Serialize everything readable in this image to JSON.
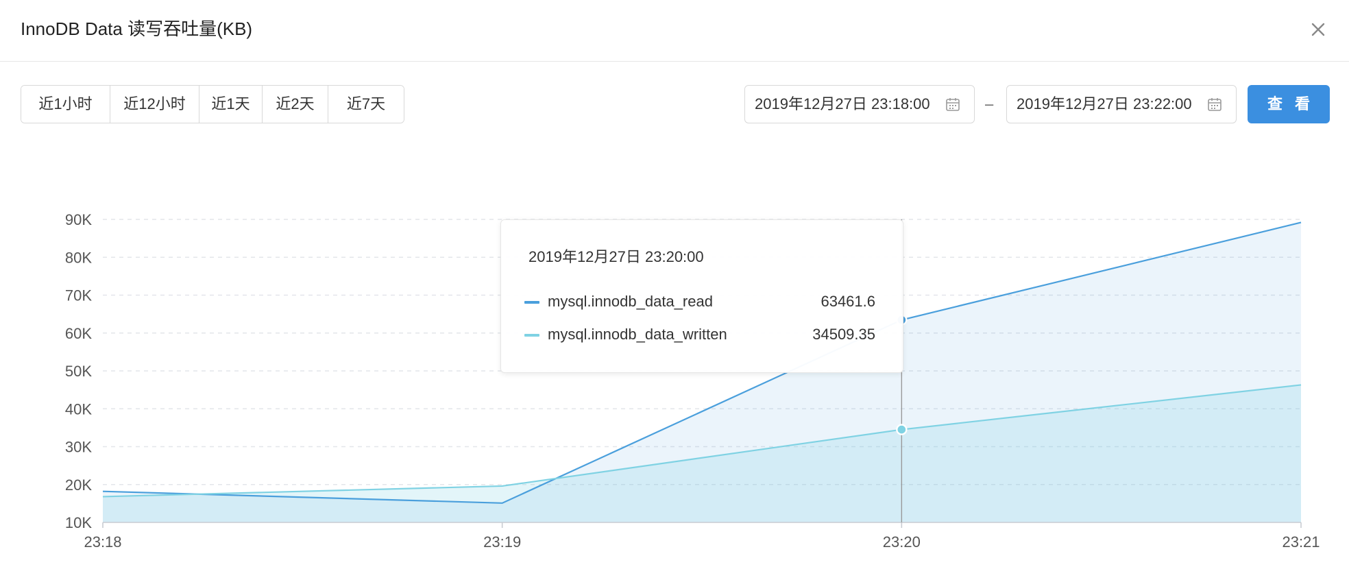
{
  "dialog": {
    "title": "InnoDB Data 读写吞吐量(KB)"
  },
  "toolbar": {
    "quick_ranges": [
      "近1小时",
      "近12小时",
      "近1天",
      "近2天",
      "近7天"
    ],
    "start_date": "2019年12月27日 23:18:00",
    "separator": "–",
    "end_date": "2019年12月27日 23:22:00",
    "view_label": "查 看"
  },
  "colors": {
    "read": "#4a9fdc",
    "written": "#7fd2e3",
    "accent": "#3b8fe0"
  },
  "icons": {
    "close": "close-icon",
    "calendar": "calendar-icon"
  },
  "tooltip": {
    "time": "2019年12月27日 23:20:00",
    "rows": [
      {
        "name": "mysql.innodb_data_read",
        "value": "63461.6"
      },
      {
        "name": "mysql.innodb_data_written",
        "value": "34509.35"
      }
    ]
  },
  "chart_data": {
    "type": "area",
    "x": [
      "23:18",
      "23:19",
      "23:20",
      "23:21"
    ],
    "series": [
      {
        "name": "mysql.innodb_data_read",
        "values": [
          18200,
          15100,
          63461.6,
          89200
        ]
      },
      {
        "name": "mysql.innodb_data_written",
        "values": [
          16800,
          19600,
          34509.35,
          46300
        ]
      }
    ],
    "yticks": [
      "10K",
      "20K",
      "30K",
      "40K",
      "50K",
      "60K",
      "70K",
      "80K",
      "90K"
    ],
    "ylim": [
      10000,
      90000
    ],
    "grid": true,
    "hover_category": "23:20"
  }
}
